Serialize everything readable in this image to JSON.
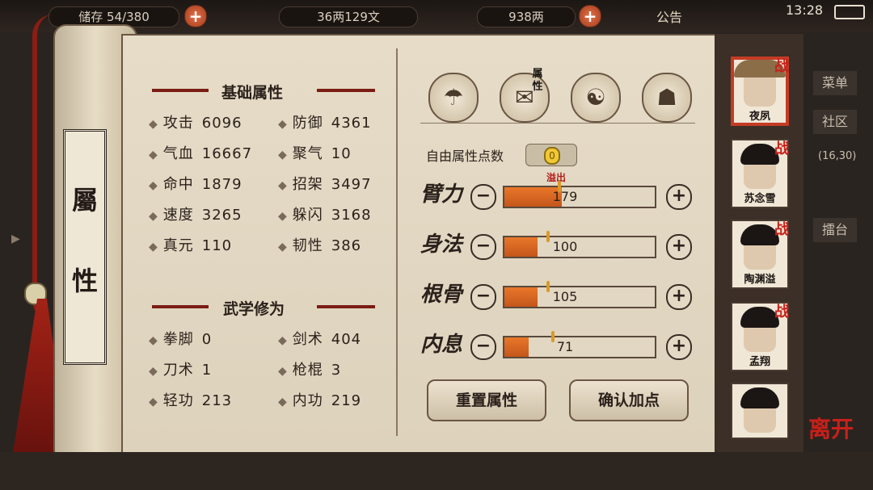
{
  "topbar": {
    "bag_label": "储存",
    "bag_count": "54/380",
    "silver": "36两129文",
    "gold": "938两",
    "notice": "公告",
    "time": "13:28"
  },
  "scroll_title": [
    "屬",
    "性"
  ],
  "basic": {
    "title": "基础属性",
    "stats": [
      {
        "name": "攻击",
        "value": "6096"
      },
      {
        "name": "防御",
        "value": "4361"
      },
      {
        "name": "气血",
        "value": "16667"
      },
      {
        "name": "聚气",
        "value": "10"
      },
      {
        "name": "命中",
        "value": "1879"
      },
      {
        "name": "招架",
        "value": "3497"
      },
      {
        "name": "速度",
        "value": "3265"
      },
      {
        "name": "躲闪",
        "value": "3168"
      },
      {
        "name": "真元",
        "value": "110"
      },
      {
        "name": "韧性",
        "value": "386"
      }
    ]
  },
  "martial": {
    "title": "武学修为",
    "stats": [
      {
        "name": "拳脚",
        "value": "0"
      },
      {
        "name": "剑术",
        "value": "404"
      },
      {
        "name": "刀术",
        "value": "1"
      },
      {
        "name": "枪棍",
        "value": "3"
      },
      {
        "name": "轻功",
        "value": "213"
      },
      {
        "name": "内功",
        "value": "219"
      }
    ]
  },
  "tabs": {
    "attr_tab_text": "属性"
  },
  "free_points": {
    "label": "自由属性点数",
    "value": "0"
  },
  "overflow_label": "溢出",
  "attributes": [
    {
      "label": "臂力",
      "value": "179",
      "fill": 0.38
    },
    {
      "label": "身法",
      "value": "100",
      "fill": 0.22
    },
    {
      "label": "根骨",
      "value": "105",
      "fill": 0.22
    },
    {
      "label": "内息",
      "value": "71",
      "fill": 0.16
    }
  ],
  "buttons": {
    "reset": "重置属性",
    "confirm": "确认加点"
  },
  "characters": [
    {
      "name": "夜夙",
      "battle": "战",
      "selected": true
    },
    {
      "name": "苏念雪",
      "battle": "战",
      "selected": false
    },
    {
      "name": "陶渊溢",
      "battle": "战",
      "selected": false
    },
    {
      "name": "孟翔",
      "battle": "战",
      "selected": false
    },
    {
      "name": "",
      "battle": "",
      "selected": false
    }
  ],
  "right_menu": [
    "菜单",
    "社区",
    "擂台"
  ],
  "right_coords": "16,30",
  "leave_label": "离开"
}
